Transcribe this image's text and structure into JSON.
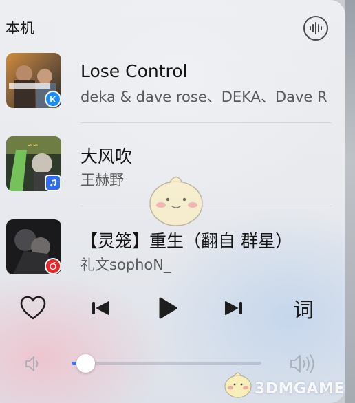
{
  "header": {
    "title": "本机",
    "cast_icon": "audio-wave-icon"
  },
  "tracks": [
    {
      "title": "Lose Control",
      "artist": "deka & dave rose、DEKA、Dave R",
      "source_icon": "kugou-icon",
      "badge_letter": "K",
      "badge_color": "#1a8cff"
    },
    {
      "title": "大风吹",
      "artist": "王赫野",
      "source_icon": "apple-music-icon",
      "badge_color": "#2f6cf5"
    },
    {
      "title": "【灵笼】重生（翻自 群星）",
      "artist": "礼文sophoN_",
      "source_icon": "netease-music-icon",
      "badge_color": "#e8272a"
    }
  ],
  "controls": {
    "like_icon": "heart-outline-icon",
    "prev_icon": "skip-previous-icon",
    "play_icon": "play-icon",
    "next_icon": "skip-next-icon",
    "lyrics_label": "词"
  },
  "volume": {
    "level": 0.06,
    "accent_color": "#3b78f0"
  },
  "watermark": {
    "brand": "3DMGAME"
  }
}
